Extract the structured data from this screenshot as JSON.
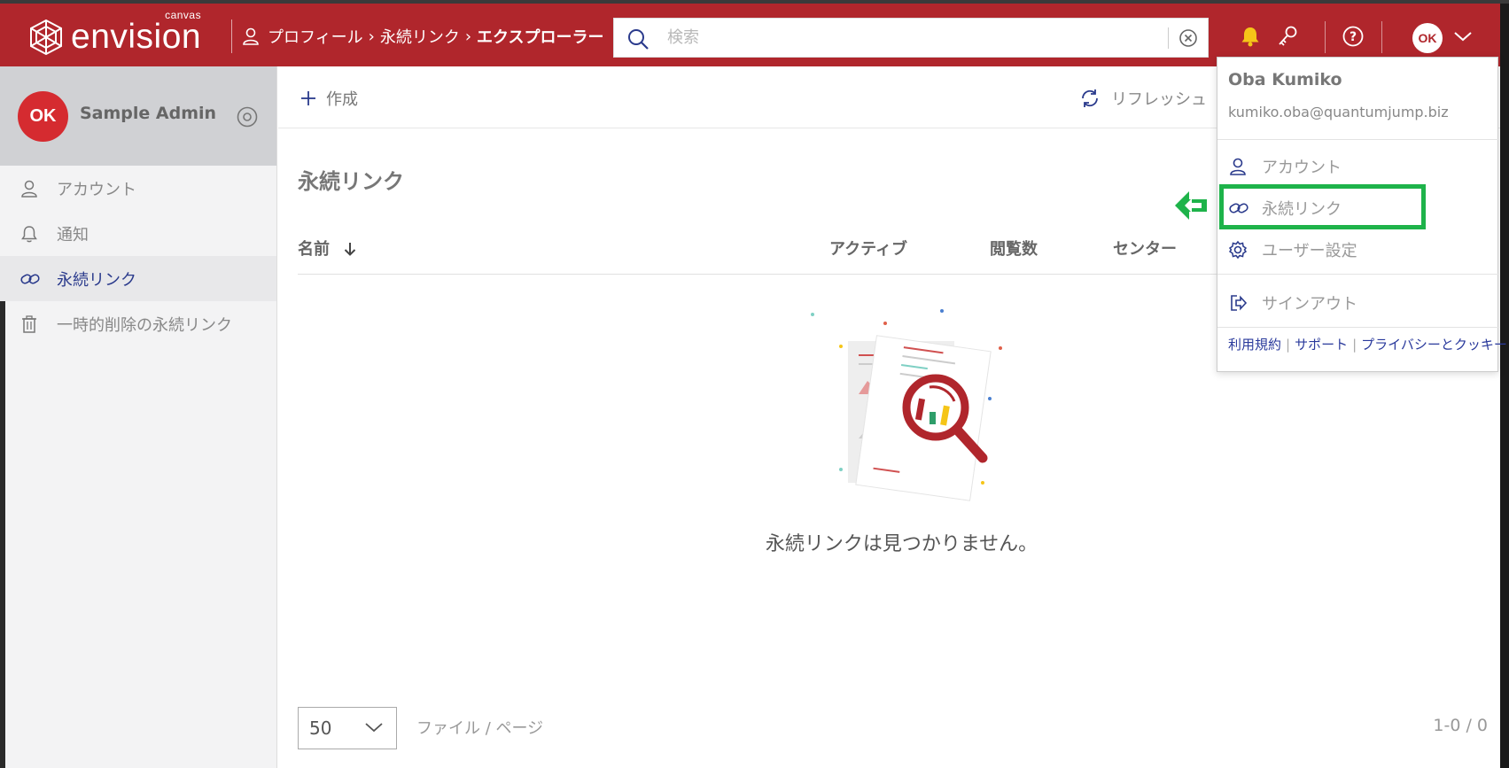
{
  "header": {
    "logo_text": "envision",
    "logo_sub": "canvas",
    "breadcrumb": [
      "プロフィール",
      "永続リンク",
      "エクスプローラー"
    ],
    "search_placeholder": "検索",
    "avatar_initials": "OK"
  },
  "sidebar": {
    "profile_name": "Sample Admin",
    "avatar_initials": "OK",
    "items": [
      {
        "label": "アカウント",
        "icon": "person-icon"
      },
      {
        "label": "通知",
        "icon": "bell-icon"
      },
      {
        "label": "永続リンク",
        "icon": "link-icon",
        "active": true
      },
      {
        "label": "一時的削除の永続リンク",
        "icon": "trash-icon"
      }
    ]
  },
  "toolbar": {
    "create_label": "作成",
    "refresh_label": "リフレッシュ"
  },
  "main": {
    "title": "永続リンク",
    "columns": [
      "名前",
      "アクティブ",
      "閲覧数",
      "センター"
    ],
    "empty_message": "永続リンクは見つかりません。",
    "pager": {
      "page_size": "50",
      "page_label": "ファイル / ページ",
      "count": "1-0 / 0"
    }
  },
  "user_menu": {
    "name": "Oba Kumiko",
    "email": "kumiko.oba@quantumjump.biz",
    "items": [
      {
        "label": "アカウント",
        "icon": "person-icon"
      },
      {
        "label": "永続リンク",
        "icon": "link-icon"
      },
      {
        "label": "ユーザー設定",
        "icon": "gear-icon"
      },
      {
        "label": "サインアウト",
        "icon": "sign-out-icon"
      }
    ],
    "footer_links": [
      "利用規約",
      "サポート",
      "プライバシーとクッキー"
    ]
  },
  "colors": {
    "brand_red": "#b0262c",
    "highlight_green": "#1eb34a",
    "link_blue": "#2a3a9c"
  }
}
